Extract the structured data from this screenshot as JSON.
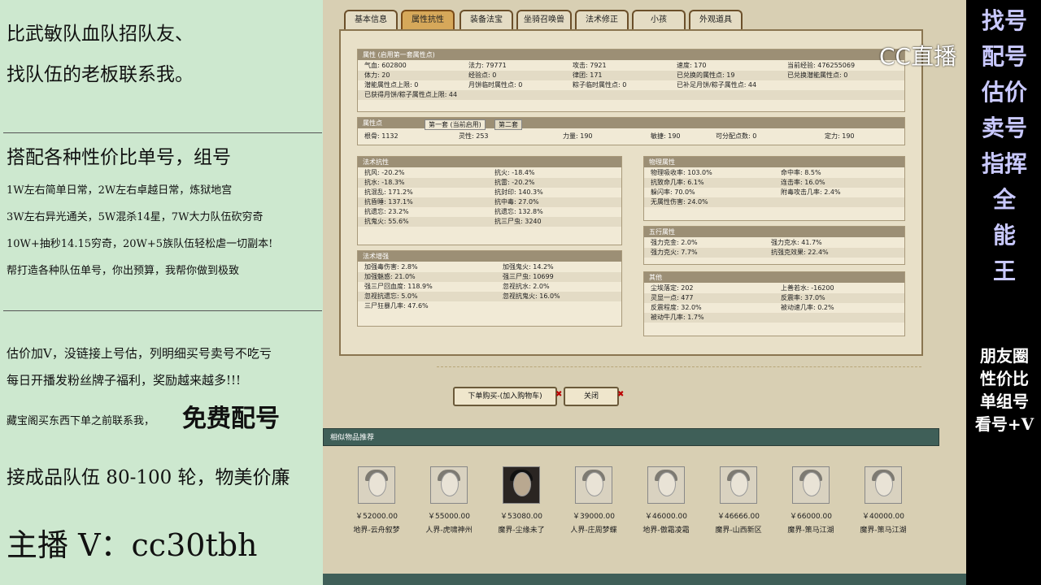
{
  "left_ad": {
    "line1": "比武敏队血队招队友、",
    "line2": "找队伍的老板联系我。",
    "heading2": "搭配各种性价比单号，组号",
    "lines": [
      "1W左右简单日常，2W左右卓越日常，炼狱地宫",
      "3W左右异光通关，5W混杀14星，7W大力队伍砍穷奇",
      "10W+抽秒14.15穷奇，20W+5族队伍轻松虐一切副本!",
      "帮打造各种队伍单号，你出预算，我帮你做到极致"
    ],
    "lines2": [
      "估价加V，没链接上号估，列明细买号卖号不吃亏",
      "每日开播发粉丝牌子福利，奖励越来越多!!!"
    ],
    "cangbao": "藏宝阁买东西下单之前联系我，",
    "free": "免费配号",
    "team": "接成品队伍 80-100 轮，物美价廉",
    "host": "主播 V：cc30tbh"
  },
  "right_ad": {
    "chars": [
      "找号",
      "配号",
      "估价",
      "卖号",
      "指挥",
      "全",
      "能",
      "王"
    ],
    "lines": [
      "朋友圈",
      "性价比",
      "单组号",
      "看号+V"
    ]
  },
  "logo": "CC直播",
  "tabs": [
    "基本信息",
    "属性抗性",
    "装备法宝",
    "坐骑召唤兽",
    "法术修正",
    "小孩",
    "外观道具"
  ],
  "attr_box": {
    "header": "属性 (启用第一套属性点)",
    "rows": [
      [
        "气血: 602800",
        "法力: 79771",
        "攻击: 7921",
        "速度: 170",
        "当前经验: 476255069"
      ],
      [
        "体力: 20",
        "经验点: 0",
        "律团: 171",
        "已兑换的属性点: 19",
        "已兑换潜能属性点: 0"
      ],
      [
        "潜能属性点上限: 0",
        "月饼临时属性点: 0",
        "粽子临时属性点: 0",
        "已补足月饼/粽子属性点: 44",
        ""
      ],
      [
        "已获得月饼/粽子属性点上限: 44",
        "",
        "",
        "",
        ""
      ]
    ]
  },
  "point_box": {
    "header": "属性点",
    "sub_tabs": [
      "第一套 (当前启用)",
      "第二套"
    ],
    "row": [
      "根骨: 1132",
      "灵性: 253",
      "力量: 190",
      "敏捷: 190",
      "可分配点数: 0",
      "定力: 190"
    ]
  },
  "resist_box": {
    "header": "法术抗性",
    "rows": [
      [
        "抗风: -20.2%",
        "抗火: -18.4%"
      ],
      [
        "抗水: -18.3%",
        "抗雷: -20.2%"
      ],
      [
        "抗混乱: 171.2%",
        "抗封印: 140.3%"
      ],
      [
        "抗昏睡: 137.1%",
        "抗中毒: 27.0%"
      ],
      [
        "抗遗忘: 23.2%",
        "抗遗忘: 132.8%"
      ],
      [
        "抗鬼火: 55.6%",
        "抗三尸虫: 3240"
      ]
    ]
  },
  "boost_box": {
    "header": "法术增强",
    "rows": [
      [
        "加强毒伤害: 2.8%",
        "加强鬼火: 14.2%"
      ],
      [
        "加强魅惑: 21.0%",
        "强三尸虫: 10699"
      ],
      [
        "强三尸回血度: 118.9%",
        "忽视抗水: 2.0%"
      ],
      [
        "忽视抗遗忘: 5.0%",
        "忽视抗鬼火: 16.0%"
      ],
      [
        "三尸狂暴几率: 47.6%",
        ""
      ]
    ]
  },
  "phys_box": {
    "header": "物理属性",
    "rows": [
      [
        "物理吸收率: 103.0%",
        "命中率: 8.5%"
      ],
      [
        "抗致命几率: 6.1%",
        "连击率: 16.0%"
      ],
      [
        "躲闪率: 70.0%",
        "附毒攻击几率: 2.4%"
      ],
      [
        "无属性伤害: 24.0%",
        ""
      ]
    ]
  },
  "five_box": {
    "header": "五行属性",
    "rows": [
      [
        "强力克金: 2.0%",
        "强力克水: 41.7%"
      ],
      [
        "强力克火: 7.7%",
        "抗强克效果: 22.4%"
      ]
    ]
  },
  "other_box": {
    "header": "其他",
    "rows": [
      [
        "尘埃落定: 202",
        "上善若水: -16200"
      ],
      [
        "灵显一点: 477",
        "反震率: 37.0%"
      ],
      [
        "反震程度: 32.0%",
        "被动速几率: 0.2%"
      ],
      [
        "被动牛几率: 1.7%",
        ""
      ]
    ]
  },
  "buttons": {
    "buy": "下单购买-(加入购物车)",
    "close": "关闭"
  },
  "recommend": {
    "title": "相似物品推荐",
    "items": [
      {
        "price": "￥52000.00",
        "server": "地界-云舟叙梦"
      },
      {
        "price": "￥55000.00",
        "server": "人界-虎啸神州"
      },
      {
        "price": "￥53080.00",
        "server": "魔界-尘缘未了"
      },
      {
        "price": "￥39000.00",
        "server": "人界-庄周梦蝶"
      },
      {
        "price": "￥46000.00",
        "server": "地界-傲霜凌霜"
      },
      {
        "price": "￥46666.00",
        "server": "魔界-山西新区"
      },
      {
        "price": "￥66000.00",
        "server": "魔界-策马江湖"
      },
      {
        "price": "￥40000.00",
        "server": "魔界-策马江湖"
      }
    ]
  }
}
